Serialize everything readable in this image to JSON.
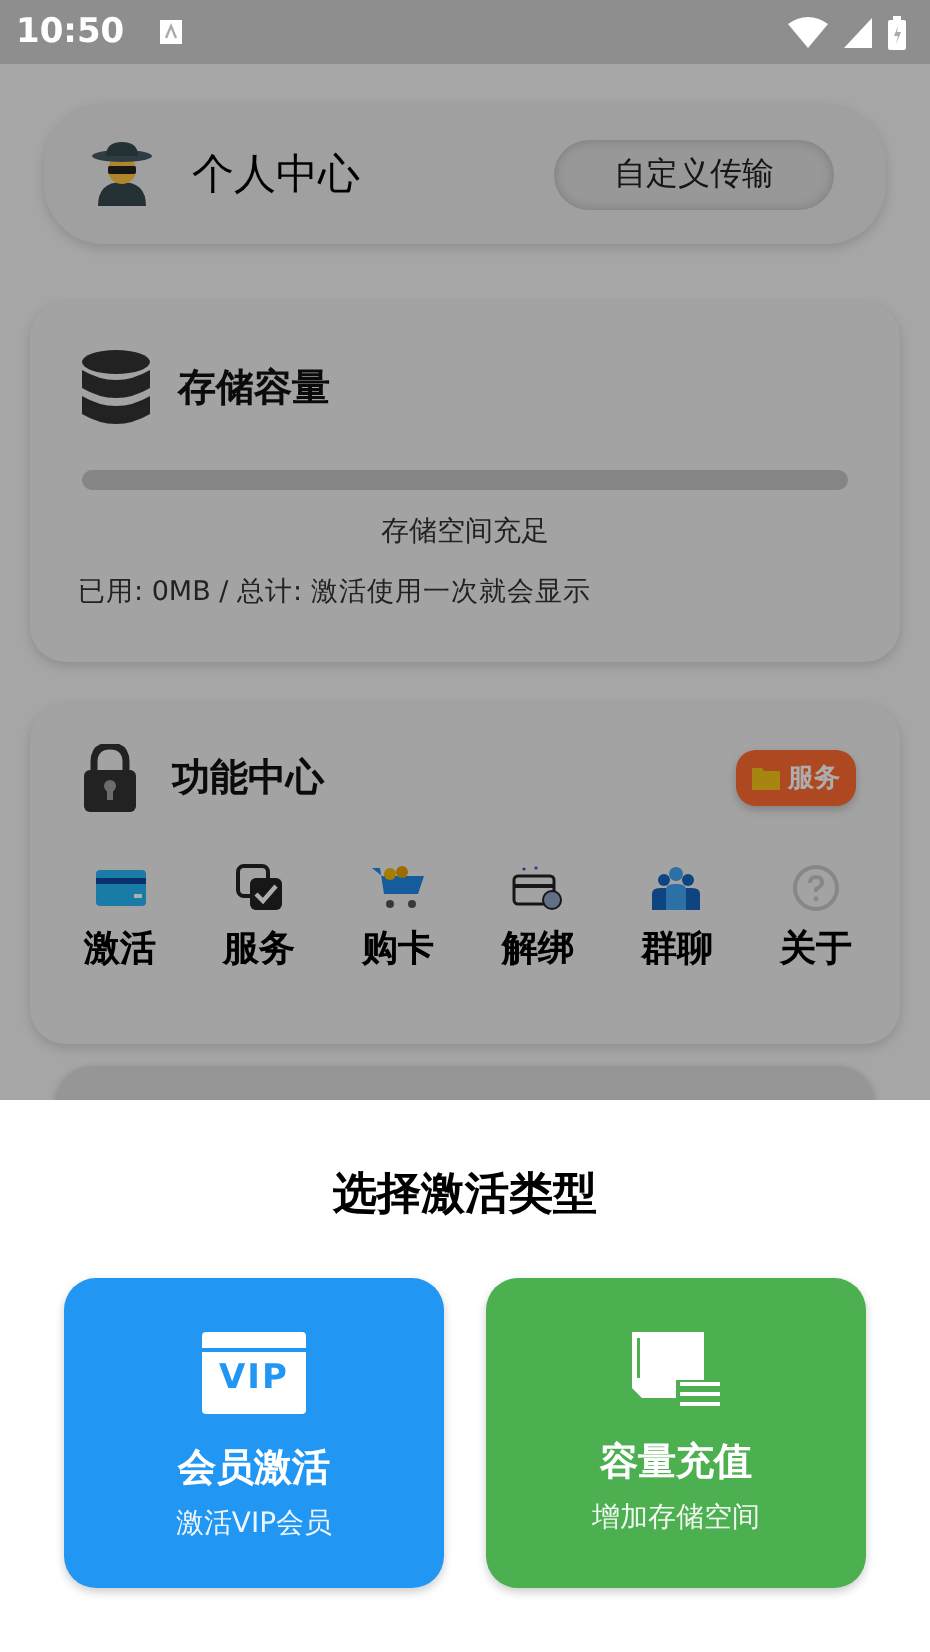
{
  "status_bar": {
    "time": "10:50"
  },
  "profile_card": {
    "title": "个人中心",
    "button": "自定义传输"
  },
  "storage_card": {
    "title": "存储容量",
    "level": 0,
    "status": "存储空间充足",
    "detail": "已用: 0MB / 总计: 激活使用一次就会显示"
  },
  "function_card": {
    "title": "功能中心",
    "badge": "服务",
    "items": [
      {
        "kind": "card",
        "label": "激活"
      },
      {
        "kind": "check",
        "label": "服务"
      },
      {
        "kind": "cart",
        "label": "购卡"
      },
      {
        "kind": "unbind",
        "label": "解绑"
      },
      {
        "kind": "group",
        "label": "群聊"
      },
      {
        "kind": "help",
        "label": "关于"
      }
    ]
  },
  "sheet": {
    "title": "选择激活类型",
    "options": [
      {
        "kind": "vip",
        "icon_text": "VIP",
        "title": "会员激活",
        "subtitle": "激活VIP会员",
        "color": "#2196f3"
      },
      {
        "kind": "storage",
        "title": "容量充值",
        "subtitle": "增加存储空间",
        "color": "#4caf50"
      }
    ]
  }
}
